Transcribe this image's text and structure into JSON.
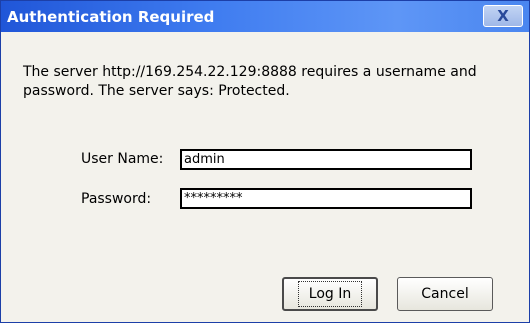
{
  "dialog": {
    "title": "Authentication Required",
    "close_glyph": "X",
    "message": "The server http://169.254.22.129:8888 requires a username and password. The server says: Protected.",
    "username_label": "User Name:",
    "username_value": "admin",
    "password_label": "Password:",
    "password_value": "*********",
    "login_label": "Log In",
    "cancel_label": "Cancel"
  },
  "colors": {
    "titlebar": "#3f7cf0",
    "dialog_bg": "#f3f2ec"
  },
  "icons": {
    "close": "close-icon"
  }
}
